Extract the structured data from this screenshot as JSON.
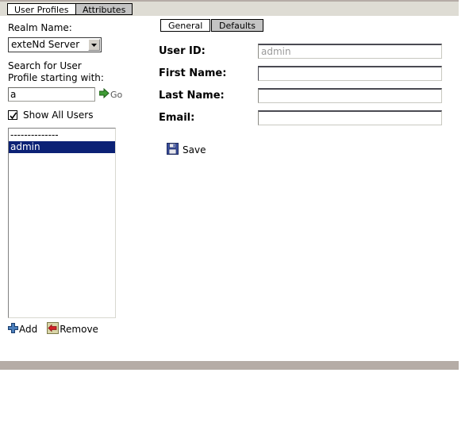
{
  "app_tabs": [
    {
      "label": "User Profiles",
      "active": true
    },
    {
      "label": "Attributes",
      "active": false
    }
  ],
  "left_panel": {
    "realm_label": "Realm Name:",
    "realm_select": {
      "value": "exteNd Server",
      "options": [
        "exteNd Server"
      ],
      "arrow_icon": "chevron-down-icon"
    },
    "search_label_line1": "Search for User",
    "search_label_line2": "Profile starting with:",
    "search_input": {
      "value": "a",
      "placeholder": ""
    },
    "go_button": {
      "label": "Go",
      "icon": "green-right-arrow-icon"
    },
    "show_all_users": {
      "label": "Show All Users",
      "checked": true
    },
    "user_list": {
      "items": [
        {
          "label": "--------------",
          "selected": false,
          "separator": true
        },
        {
          "label": "admin",
          "selected": true,
          "separator": false
        }
      ]
    },
    "add_button": {
      "label": "Add",
      "icon": "blue-plus-icon"
    },
    "remove_button": {
      "label": "Remove",
      "icon": "red-left-arrow-icon"
    }
  },
  "right_panel": {
    "tabs": [
      {
        "label": "General",
        "active": true
      },
      {
        "label": "Defaults",
        "active": false
      }
    ],
    "fields": [
      {
        "label": "User ID:",
        "value": "admin",
        "disabled": true,
        "focused": false
      },
      {
        "label": "First Name:",
        "value": "",
        "disabled": false,
        "focused": true
      },
      {
        "label": "Last Name:",
        "value": "",
        "disabled": false,
        "focused": false
      },
      {
        "label": "Email:",
        "value": "",
        "disabled": false,
        "focused": false
      }
    ],
    "save_button": {
      "label": "Save",
      "icon": "floppy-disk-save-icon"
    }
  },
  "colors": {
    "top_band": "#dedcd4",
    "band_rule": "#b5aca6",
    "tab_active": "#ffffff",
    "tab_inactive": "#c4c4c4",
    "selection": "#0b2175",
    "disabled_text": "#9a9a9a"
  }
}
